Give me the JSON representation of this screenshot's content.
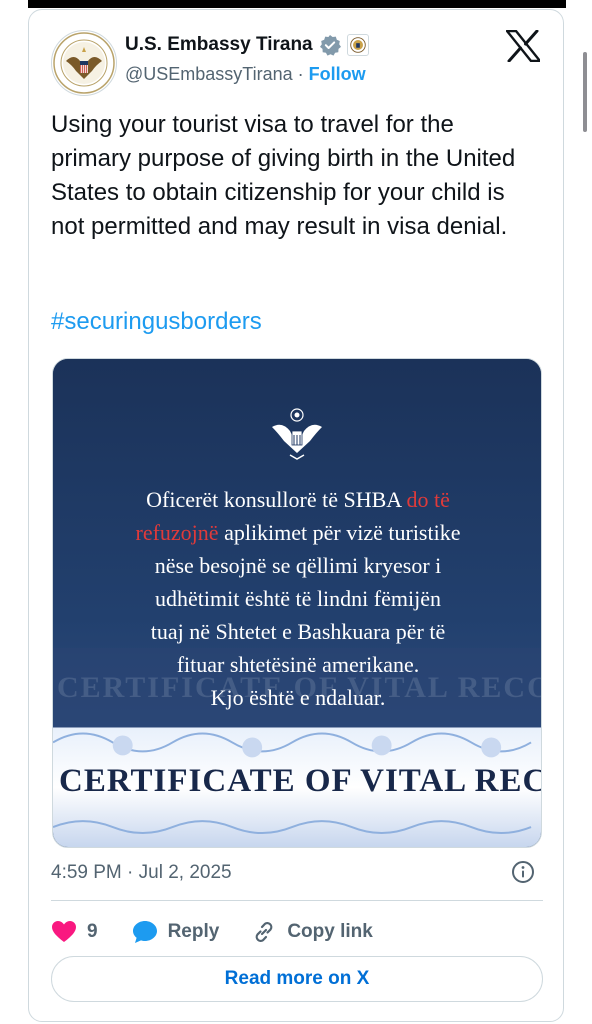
{
  "account": {
    "name": "U.S. Embassy Tirana",
    "handle": "@USEmbassyTirana",
    "separator": "·",
    "follow_label": "Follow"
  },
  "tweet": {
    "text": "Using your tourist visa to travel for the primary purpose of giving birth in the United States to obtain citizenship for your child is not permitted and may result in visa denial.",
    "hashtag": "#securingusborders",
    "timestamp": "4:59 PM · Jul 2, 2025"
  },
  "media": {
    "line1_a": "Oficerët konsullorë të SHBA ",
    "line1_red": "do të",
    "line2_red": "refuzojnë",
    "line2_b": " aplikimet për vizë turistike",
    "line3": "nëse besojnë se qëllimi kryesor i",
    "line4": "udhëtimit është të lindni fëmijën",
    "line5": "tuaj në Shtetet e Bashkuara për të",
    "line6": "fituar shtetësinë amerikane.",
    "line7": "Kjo është e ndaluar.",
    "certificate_text": "CERTIFICATE OF VITAL REC",
    "ghost_text": "CERTIFICATE OF VITAL RECO",
    "accent_red": "#e03a3a",
    "navy": "#1d3560"
  },
  "actions": {
    "like_count": "9",
    "reply_label": "Reply",
    "copy_label": "Copy link"
  },
  "footer": {
    "read_more_label": "Read more on X"
  },
  "colors": {
    "link_blue": "#1d9bf0",
    "like_pink": "#f91880",
    "reply_blue": "#1d9bf0",
    "verified_gray": "#829aab"
  }
}
